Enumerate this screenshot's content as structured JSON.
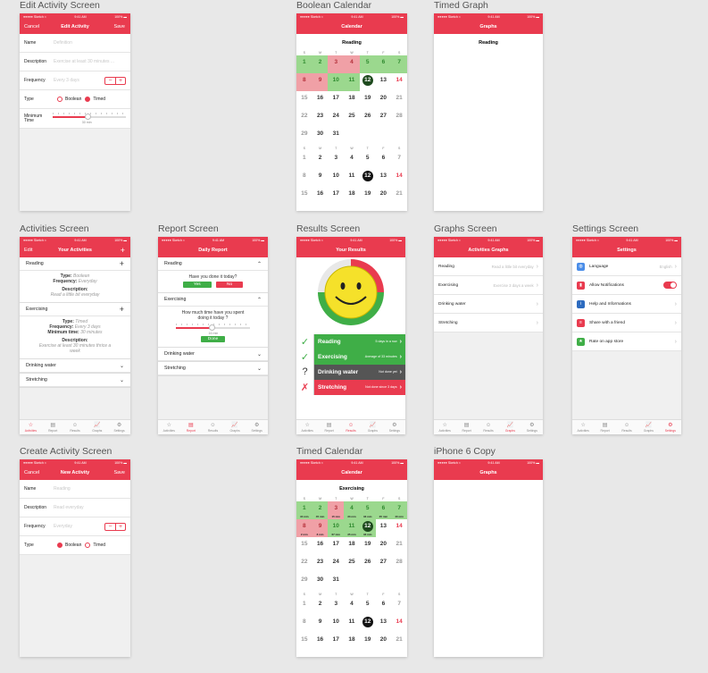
{
  "status": {
    "carrier": "●●●●● Sketch ≈",
    "time": "9:41 AM",
    "battery": "100% ▬"
  },
  "tabs": [
    "Activities",
    "Report",
    "Results",
    "Graphs",
    "Settings"
  ],
  "boards": {
    "edit": {
      "label": "Edit Activity Screen",
      "nav": {
        "left": "Cancel",
        "title": "Edit Activity",
        "right": "Save"
      },
      "name_label": "Name",
      "name_ph": "Definition",
      "desc_label": "Description",
      "desc_ph": "Exercise at least 30 minutes ...",
      "freq_label": "Frequency",
      "freq_ph": "Every 3 days",
      "type_label": "Type",
      "type_opt1": "Boolean",
      "type_opt2": "Timed",
      "min_label": "Minimum Time",
      "slider_value": "30 min"
    },
    "bool_cal": {
      "label": "Boolean Calendar",
      "nav_title": "Calendar",
      "activity": "Reading"
    },
    "timed_graph": {
      "label": "Timed Graph",
      "nav_title": "Graphs",
      "activity": "Reading"
    },
    "activities": {
      "label": "Activities Screen",
      "nav": {
        "left": "Edit",
        "title": "Your Activities",
        "right": "+"
      },
      "reading": {
        "title": "Reading",
        "type_k": "Type:",
        "type_v": "Boolean",
        "freq_k": "Frequency:",
        "freq_v": "Everyday",
        "desc_k": "Description:",
        "desc_v": "Read a little bit everyday"
      },
      "exercising": {
        "title": "Exercising",
        "type_k": "Type:",
        "type_v": "Timed",
        "freq_k": "Frequency:",
        "freq_v": "Every 3 days",
        "min_k": "Minimum time:",
        "min_v": "30 minutes",
        "desc_k": "Description:",
        "desc_v": "Exercise at least 30 minutes thrice a week"
      },
      "drinking": "Drinking water",
      "stretching": "Stretching"
    },
    "report": {
      "label": "Report Screen",
      "nav_title": "Daily Report",
      "reading": "Reading",
      "q1": "Have you done it today?",
      "yes": "Yes",
      "no": "No",
      "exercising": "Exercising",
      "q2": "How much time have you spent doing it today ?",
      "slider_value": "16 min",
      "done": "Done",
      "drinking": "Drinking water",
      "stretching": "Stretching"
    },
    "results": {
      "label": "Results Screen",
      "nav_title": "Your Results",
      "rows": [
        {
          "mark": "✓",
          "name": "Reading",
          "detail": "5 days in a row"
        },
        {
          "mark": "✓",
          "name": "Exercising",
          "detail": "Average of 33 minutes"
        },
        {
          "mark": "?",
          "name": "Drinking water",
          "detail": "Not done yet"
        },
        {
          "mark": "✗",
          "name": "Stretching",
          "detail": "Not done since 3 days"
        }
      ]
    },
    "graphs": {
      "label": "Graphs Screen",
      "nav_title": "Activities Graphs",
      "rows": [
        {
          "name": "Reading",
          "detail": "Read a little bit everyday"
        },
        {
          "name": "Exercising",
          "detail": "Exercise 3 days a week"
        },
        {
          "name": "Drinking water",
          "detail": ""
        },
        {
          "name": "Stretching",
          "detail": ""
        }
      ]
    },
    "settings": {
      "label": "Settings Screen",
      "nav_title": "Settings",
      "rows": [
        {
          "name": "Language",
          "detail": "English"
        },
        {
          "name": "Allow Notifications",
          "detail": ""
        },
        {
          "name": "Help and Informations",
          "detail": ""
        },
        {
          "name": "Share with a friend",
          "detail": ""
        },
        {
          "name": "Rate on app store",
          "detail": ""
        }
      ]
    },
    "create": {
      "label": "Create Activity Screen",
      "nav": {
        "left": "Cancel",
        "title": "New Activity",
        "right": "Save"
      },
      "name_label": "Name",
      "name_ph": "Reading",
      "desc_label": "Description",
      "desc_ph": "Read everyday",
      "freq_label": "Frequency",
      "freq_ph": "Everyday",
      "type_label": "Type",
      "type_opt1": "Boolean",
      "type_opt2": "Timed"
    },
    "timed_cal": {
      "label": "Timed Calendar",
      "nav_title": "Calendar",
      "activity": "Exercising"
    },
    "iphone6": {
      "label": "iPhone 6 Copy",
      "nav_title": "Graphs"
    }
  },
  "colors": {
    "accent": "#e93b4f",
    "green": "#3fae47",
    "dark": "#555555",
    "red": "#e93b4f"
  }
}
